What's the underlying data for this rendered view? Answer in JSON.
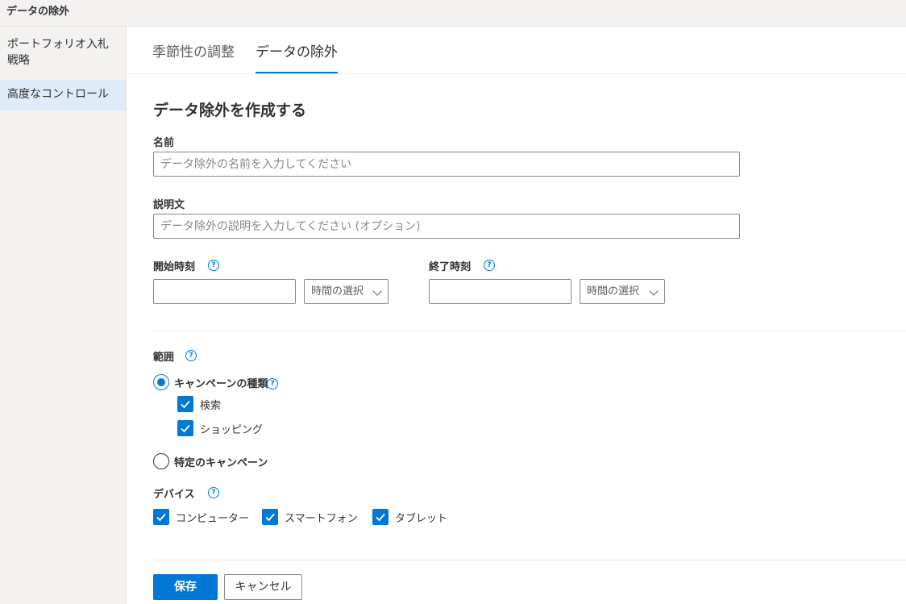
{
  "topbar": {
    "title": "データの除外"
  },
  "sidebar": {
    "items": [
      {
        "label": "ポートフォリオ入札戦略"
      },
      {
        "label": "高度なコントロール"
      }
    ]
  },
  "tabs": [
    {
      "label": "季節性の調整"
    },
    {
      "label": "データの除外"
    }
  ],
  "form": {
    "heading": "データ除外を作成する",
    "name_label": "名前",
    "name_placeholder": "データ除外の名前を入力してください",
    "desc_label": "説明文",
    "desc_placeholder": "データ除外の説明を入力してください (オプション)",
    "start_label": "開始時刻",
    "end_label": "終了時刻",
    "time_select_placeholder": "時間の選択",
    "help_glyph": "?",
    "scope_label": "範囲",
    "scope_options": {
      "campaign_type": "キャンペーンの種類",
      "specific": "特定のキャンペーン"
    },
    "campaign_types": [
      {
        "label": "検索",
        "checked": true
      },
      {
        "label": "ショッピング",
        "checked": true
      }
    ],
    "device_label": "デバイス",
    "devices": [
      {
        "label": "コンピューター",
        "checked": true
      },
      {
        "label": "スマートフォン",
        "checked": true
      },
      {
        "label": "タブレット",
        "checked": true
      }
    ]
  },
  "buttons": {
    "save": "保存",
    "cancel": "キャンセル"
  },
  "colors": {
    "accent": "#0078d4",
    "sidebar_bg": "#f3f2f1",
    "selected_bg": "#deecf9"
  }
}
